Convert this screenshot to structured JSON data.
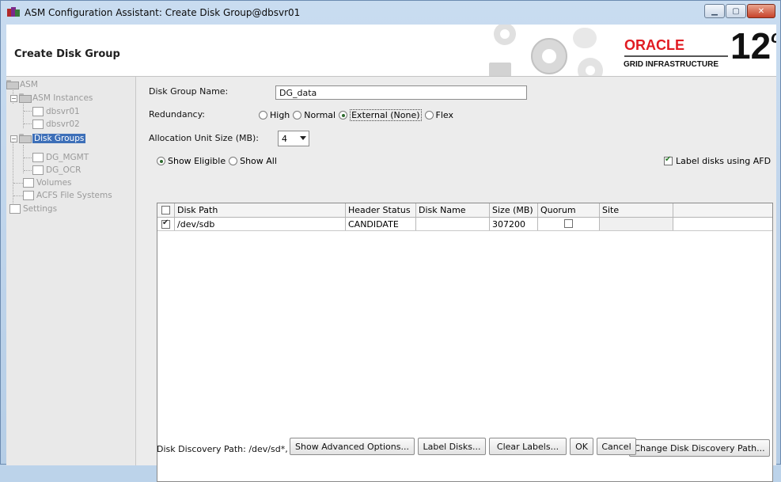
{
  "window": {
    "title": "ASM Configuration Assistant: Create Disk Group@dbsvr01",
    "controls": [
      "minimize-icon",
      "maximize-icon",
      "close-icon"
    ]
  },
  "banner": {
    "heading": "Create Disk Group",
    "brand": "ORACLE",
    "product": "GRID INFRASTRUCTURE",
    "version": "12",
    "version_suffix": "c",
    "colors": {
      "brand": "#e11b22"
    }
  },
  "nav": {
    "root": "ASM",
    "instances": "ASM Instances",
    "instance_items": [
      "dbsvr01",
      "dbsvr02"
    ],
    "disk_groups": "Disk Groups",
    "disk_group_items": [
      "DG_MGMT",
      "DG_OCR"
    ],
    "volumes": "Volumes",
    "acfs": "ACFS File Systems",
    "settings": "Settings"
  },
  "form": {
    "dg_name_label": "Disk Group Name:",
    "dg_name_value": "DG_data",
    "redundancy_label": "Redundancy:",
    "redundancy_options": [
      "High",
      "Normal",
      "External (None)",
      "Flex"
    ],
    "redundancy_selected": "External (None)",
    "au_label": "Allocation Unit Size (MB):",
    "au_value": "4",
    "show_eligible": "Show Eligible",
    "show_all": "Show All",
    "label_afd": "Label disks using AFD"
  },
  "table": {
    "columns": [
      "Disk Path",
      "Header Status",
      "Disk Name",
      "Size (MB)",
      "Quorum",
      "Site"
    ],
    "rows": [
      {
        "checked": true,
        "disk_path": "/dev/sdb",
        "header_status": "CANDIDATE",
        "disk_name": "",
        "size_mb": "307200",
        "quorum": false,
        "site": ""
      }
    ]
  },
  "footer": {
    "discovery_path": "Disk Discovery Path: /dev/sd*, AFD:*",
    "change_discovery": "Change Disk Discovery Path...",
    "show_advanced": "Show Advanced Options...",
    "label_disks": "Label Disks...",
    "clear_labels": "Clear Labels...",
    "ok": "OK",
    "cancel": "Cancel"
  }
}
